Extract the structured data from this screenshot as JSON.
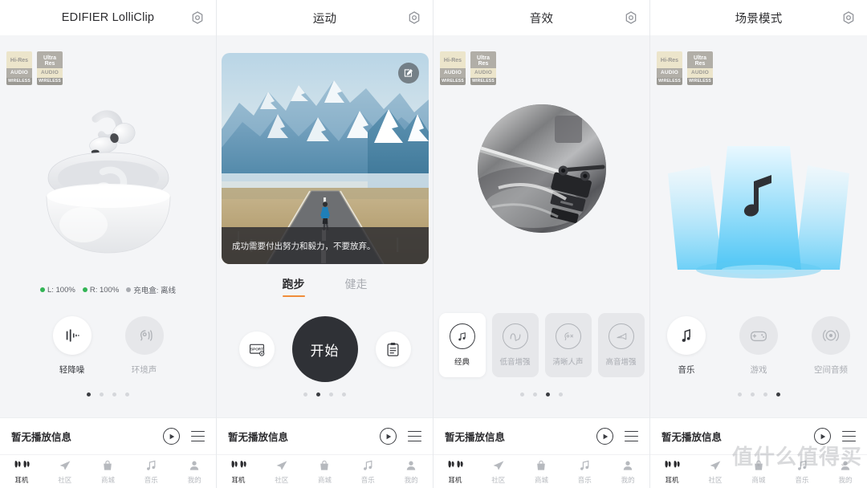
{
  "badges": {
    "hires": {
      "line1": "Hi-Res",
      "line2": "AUDIO",
      "line3": "WIRELESS"
    },
    "ultra": {
      "line1": "Ultra",
      "line1b": "Res",
      "line2": "AUDIO",
      "line3": "WIRELESS"
    }
  },
  "panels": [
    {
      "id": "device",
      "title": "EDIFIER LolliClip",
      "gear": "gear-icon",
      "battery": {
        "left": "L: 100%",
        "right": "R: 100%",
        "case": "充电盒: 离线",
        "left_color": "#32b455",
        "right_color": "#32b455",
        "case_color": "#a8abb0"
      },
      "modes": [
        {
          "label": "轻降噪",
          "icon": "noise-cancel-icon",
          "active": true
        },
        {
          "label": "环境声",
          "icon": "ambient-sound-icon",
          "active": false
        }
      ],
      "pager": {
        "count": 4,
        "active": 0
      }
    },
    {
      "id": "sport",
      "title": "运动",
      "gear": "gear-icon",
      "quote": "成功需要付出努力和毅力，不要放弃。",
      "edit_icon": "edit-icon",
      "tabs": [
        {
          "label": "跑步",
          "active": true
        },
        {
          "label": "健走",
          "active": false
        }
      ],
      "controls": {
        "settings_icon": "sport-settings-icon",
        "start_label": "开始",
        "records_icon": "records-clipboard-icon"
      },
      "pager": {
        "count": 4,
        "active": 1
      }
    },
    {
      "id": "sound",
      "title": "音效",
      "gear": "gear-icon",
      "eq_presets": [
        {
          "label": "经典",
          "icon": "music-note-icon",
          "active": true
        },
        {
          "label": "低音增强",
          "icon": "sine-wave-icon",
          "active": false
        },
        {
          "label": "清晰人声",
          "icon": "voice-icon",
          "active": false
        },
        {
          "label": "高音增强",
          "icon": "trumpet-icon",
          "active": false
        }
      ],
      "pager": {
        "count": 4,
        "active": 2
      }
    },
    {
      "id": "scene",
      "title": "场景模式",
      "gear": "gear-icon",
      "modes": [
        {
          "label": "音乐",
          "icon": "music-note-icon",
          "active": true
        },
        {
          "label": "游戏",
          "icon": "gamepad-icon",
          "active": false
        },
        {
          "label": "空间音频",
          "icon": "spatial-audio-icon",
          "active": false
        }
      ],
      "pager": {
        "count": 4,
        "active": 3
      }
    }
  ],
  "player": {
    "title": "暂无播放信息",
    "play_icon": "play-icon",
    "playlist_icon": "playlist-icon"
  },
  "nav": [
    {
      "label": "耳机",
      "icon": "earbuds-icon",
      "active": true
    },
    {
      "label": "社区",
      "icon": "paper-plane-icon",
      "active": false
    },
    {
      "label": "商城",
      "icon": "shopping-bag-icon",
      "active": false
    },
    {
      "label": "音乐",
      "icon": "music-note-icon",
      "active": false
    },
    {
      "label": "我的",
      "icon": "person-icon",
      "active": false
    }
  ],
  "watermark": "值什么值得买"
}
